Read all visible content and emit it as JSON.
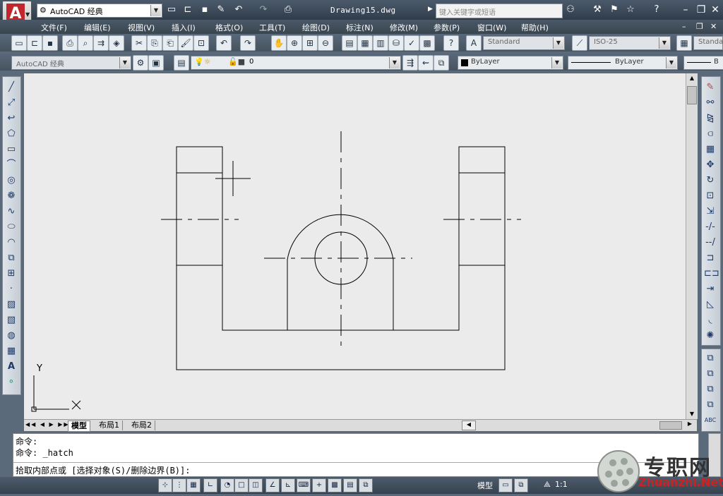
{
  "titlebar": {
    "workspace": "AutoCAD 经典",
    "document_title": "Drawing15.dwg",
    "search_placeholder": "键入关键字或短语"
  },
  "menu": [
    "文件(F)",
    "编辑(E)",
    "视图(V)",
    "插入(I)",
    "格式(O)",
    "工具(T)",
    "绘图(D)",
    "标注(N)",
    "修改(M)",
    "参数(P)",
    "窗口(W)",
    "帮助(H)"
  ],
  "toolbar": {
    "text_style": "Standard",
    "dim_style": "ISO-25",
    "table_style": "Standa",
    "workspace_combo": "AutoCAD 经典",
    "layer": "0",
    "color": "ByLayer",
    "linetype": "ByLayer",
    "lineweight": "B"
  },
  "layout_tabs": [
    "模型",
    "布局1",
    "布局2"
  ],
  "command": {
    "line1": "命令:",
    "line2": "命令: _hatch",
    "prompt": "拾取内部点或 [选择对象(S)/删除边界(B)]:"
  },
  "status": {
    "model": "模型",
    "scale": "1:1"
  },
  "ucs": {
    "x": "X",
    "y": "Y"
  },
  "watermark": {
    "cn": "专职网",
    "en": "Zhuanzhi.Net"
  },
  "colors": {
    "canvas": "#ebebeb",
    "chrome": "#4b5a6b",
    "app_red": "#c0262b"
  }
}
